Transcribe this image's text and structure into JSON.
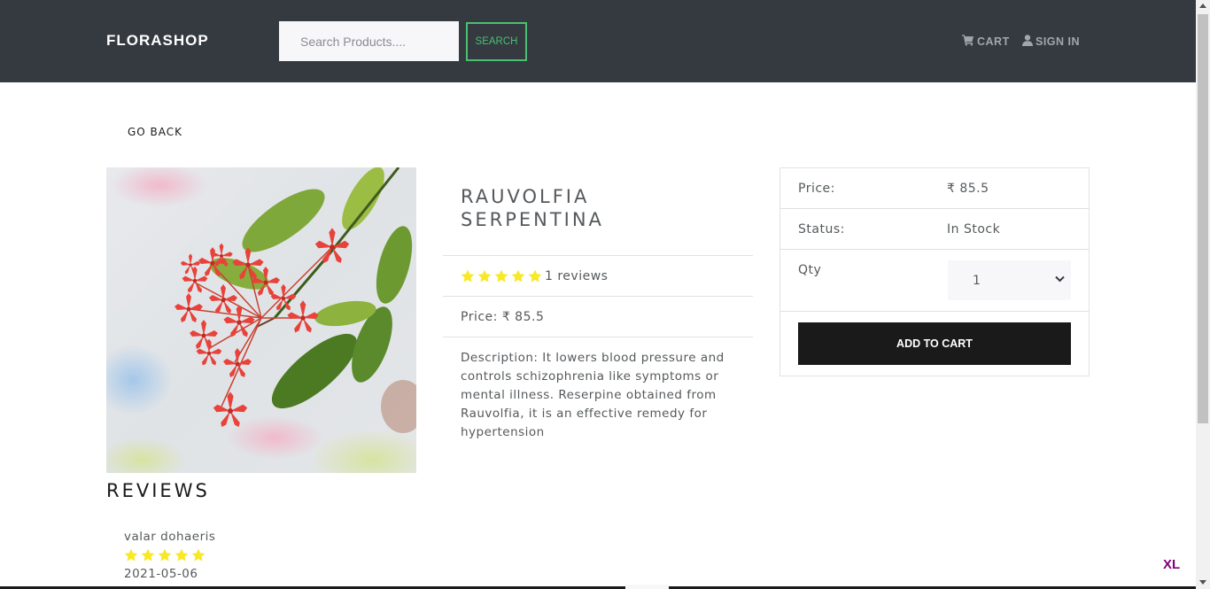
{
  "navbar": {
    "brand": "FLORASHOP",
    "search_placeholder": "Search Products....",
    "search_button": "SEARCH",
    "cart_label": "CART",
    "signin_label": "SIGN IN"
  },
  "go_back": "GO BACK",
  "product": {
    "title": "Rauvolfia Serpentina",
    "rating_stars": 5,
    "reviews_text": "1 reviews",
    "price_line": "Price: ₹ 85.5",
    "description": "Description: It lowers blood pressure and controls schizophrenia like symptoms or mental illness. Reserpine obtained from Rauvolfia, it is an effective remedy for hypertension"
  },
  "card": {
    "price_label": "Price:",
    "price_value": "₹ 85.5",
    "status_label": "Status:",
    "status_value": "In Stock",
    "qty_label": "Qty",
    "qty_value": "1",
    "add_button": "ADD TO CART"
  },
  "reviews": {
    "heading": "REVIEWS",
    "items": [
      {
        "name": "valar dohaeris",
        "rating": 5,
        "date": "2021-05-06"
      }
    ]
  },
  "badge": "XL",
  "colors": {
    "navbar_bg": "#343a40",
    "accent_green": "#4bbf73",
    "star": "#f8e825",
    "button_dark": "#1a1a1a"
  }
}
